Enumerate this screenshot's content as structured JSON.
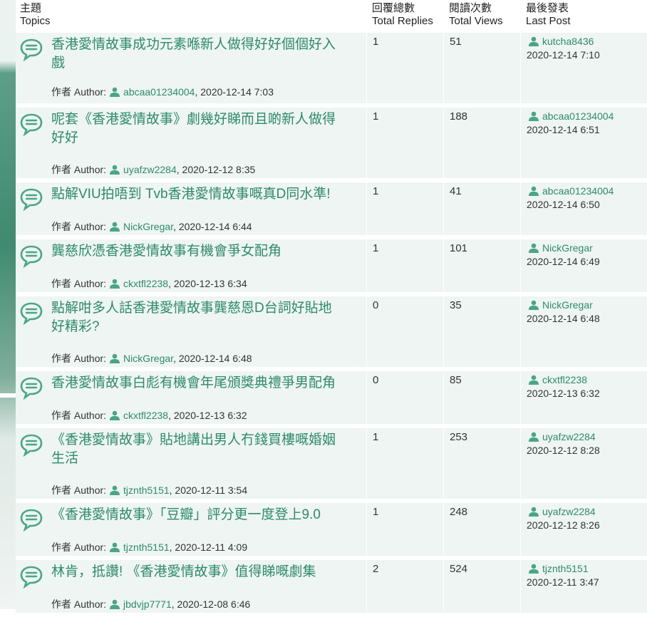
{
  "header": {
    "topics_zh": "主題",
    "topics_en": "Topics",
    "replies_zh": "回覆總數",
    "replies_en": "Total Replies",
    "views_zh": "閱讀次數",
    "views_en": "Total Views",
    "last_zh": "最後發表",
    "last_en": "Last Post"
  },
  "author_label": "作者 Author:",
  "topics": [
    {
      "title": "香港愛情故事成功元素喺新人做得好好個個好入戲",
      "author": "abcaa01234004",
      "date": ", 2020-12-14 7:03",
      "replies": "1",
      "views": "51",
      "last_user": "kutcha8436",
      "last_date": "2020-12-14 7:10"
    },
    {
      "title": "呢套《香港愛情故事》劇幾好睇而且啲新人做得好好",
      "author": "uyafzw2284",
      "date": ", 2020-12-12 8:35",
      "replies": "1",
      "views": "188",
      "last_user": "abcaa01234004",
      "last_date": "2020-12-14 6:51"
    },
    {
      "title": "點解VIU拍唔到 Tvb香港愛情故事嘅真D同水準!",
      "author": "NickGregar",
      "date": ", 2020-12-14 6:44",
      "replies": "1",
      "views": "41",
      "last_user": "abcaa01234004",
      "last_date": "2020-12-14 6:50"
    },
    {
      "title": "龔慈欣憑香港愛情故事有機會爭女配角",
      "author": "ckxtfl2238",
      "date": ", 2020-12-13 6:34",
      "replies": "1",
      "views": "101",
      "last_user": "NickGregar",
      "last_date": "2020-12-14 6:49"
    },
    {
      "title": "點解咁多人話香港愛情故事龔慈恩D台詞好貼地好精彩?",
      "author": "NickGregar",
      "date": ", 2020-12-14 6:48",
      "replies": "0",
      "views": "35",
      "last_user": "NickGregar",
      "last_date": "2020-12-14 6:48"
    },
    {
      "title": "香港愛情故事白彪有機會年尾頒獎典禮爭男配角",
      "author": "ckxtfl2238",
      "date": ", 2020-12-13 6:32",
      "replies": "0",
      "views": "85",
      "last_user": "ckxtfl2238",
      "last_date": "2020-12-13 6:32"
    },
    {
      "title": "《香港愛情故事》貼地講出男人冇錢買樓嘅婚姻生活",
      "author": "tjznth5151",
      "date": ", 2020-12-11 3:54",
      "replies": "1",
      "views": "253",
      "last_user": "uyafzw2284",
      "last_date": "2020-12-12 8:28"
    },
    {
      "title": "《香港愛情故事》「豆瓣」評分更一度登上9.0",
      "author": "tjznth5151",
      "date": ", 2020-12-11 4:09",
      "replies": "1",
      "views": "248",
      "last_user": "uyafzw2284",
      "last_date": "2020-12-12 8:26"
    },
    {
      "title": "林肯，抵讚! 《香港愛情故事》值得睇嘅劇集",
      "author": "jbdvjp7771",
      "date": ", 2020-12-08 6:46",
      "replies": "2",
      "views": "524",
      "last_user": "tjznth5151",
      "last_date": "2020-12-11 3:47"
    }
  ],
  "colors": {
    "accent": "#2f8a6b",
    "row_bg": "#eef5f2"
  },
  "icons": {
    "topic": "speech-bubble-icon",
    "user": "user-icon"
  }
}
